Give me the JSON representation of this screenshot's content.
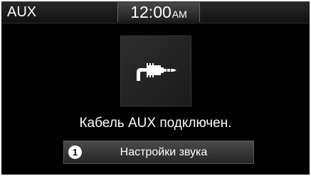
{
  "status_bar": {
    "mode": "AUX",
    "time": "12:00",
    "ampm": "AM"
  },
  "main": {
    "icon": "aux-cable-icon",
    "message": "Кабель AUX подключен."
  },
  "sound_button": {
    "number": "1",
    "label": "Настройки звука"
  },
  "colors": {
    "background": "#000000",
    "text": "#ffffff",
    "button": "#333333"
  }
}
